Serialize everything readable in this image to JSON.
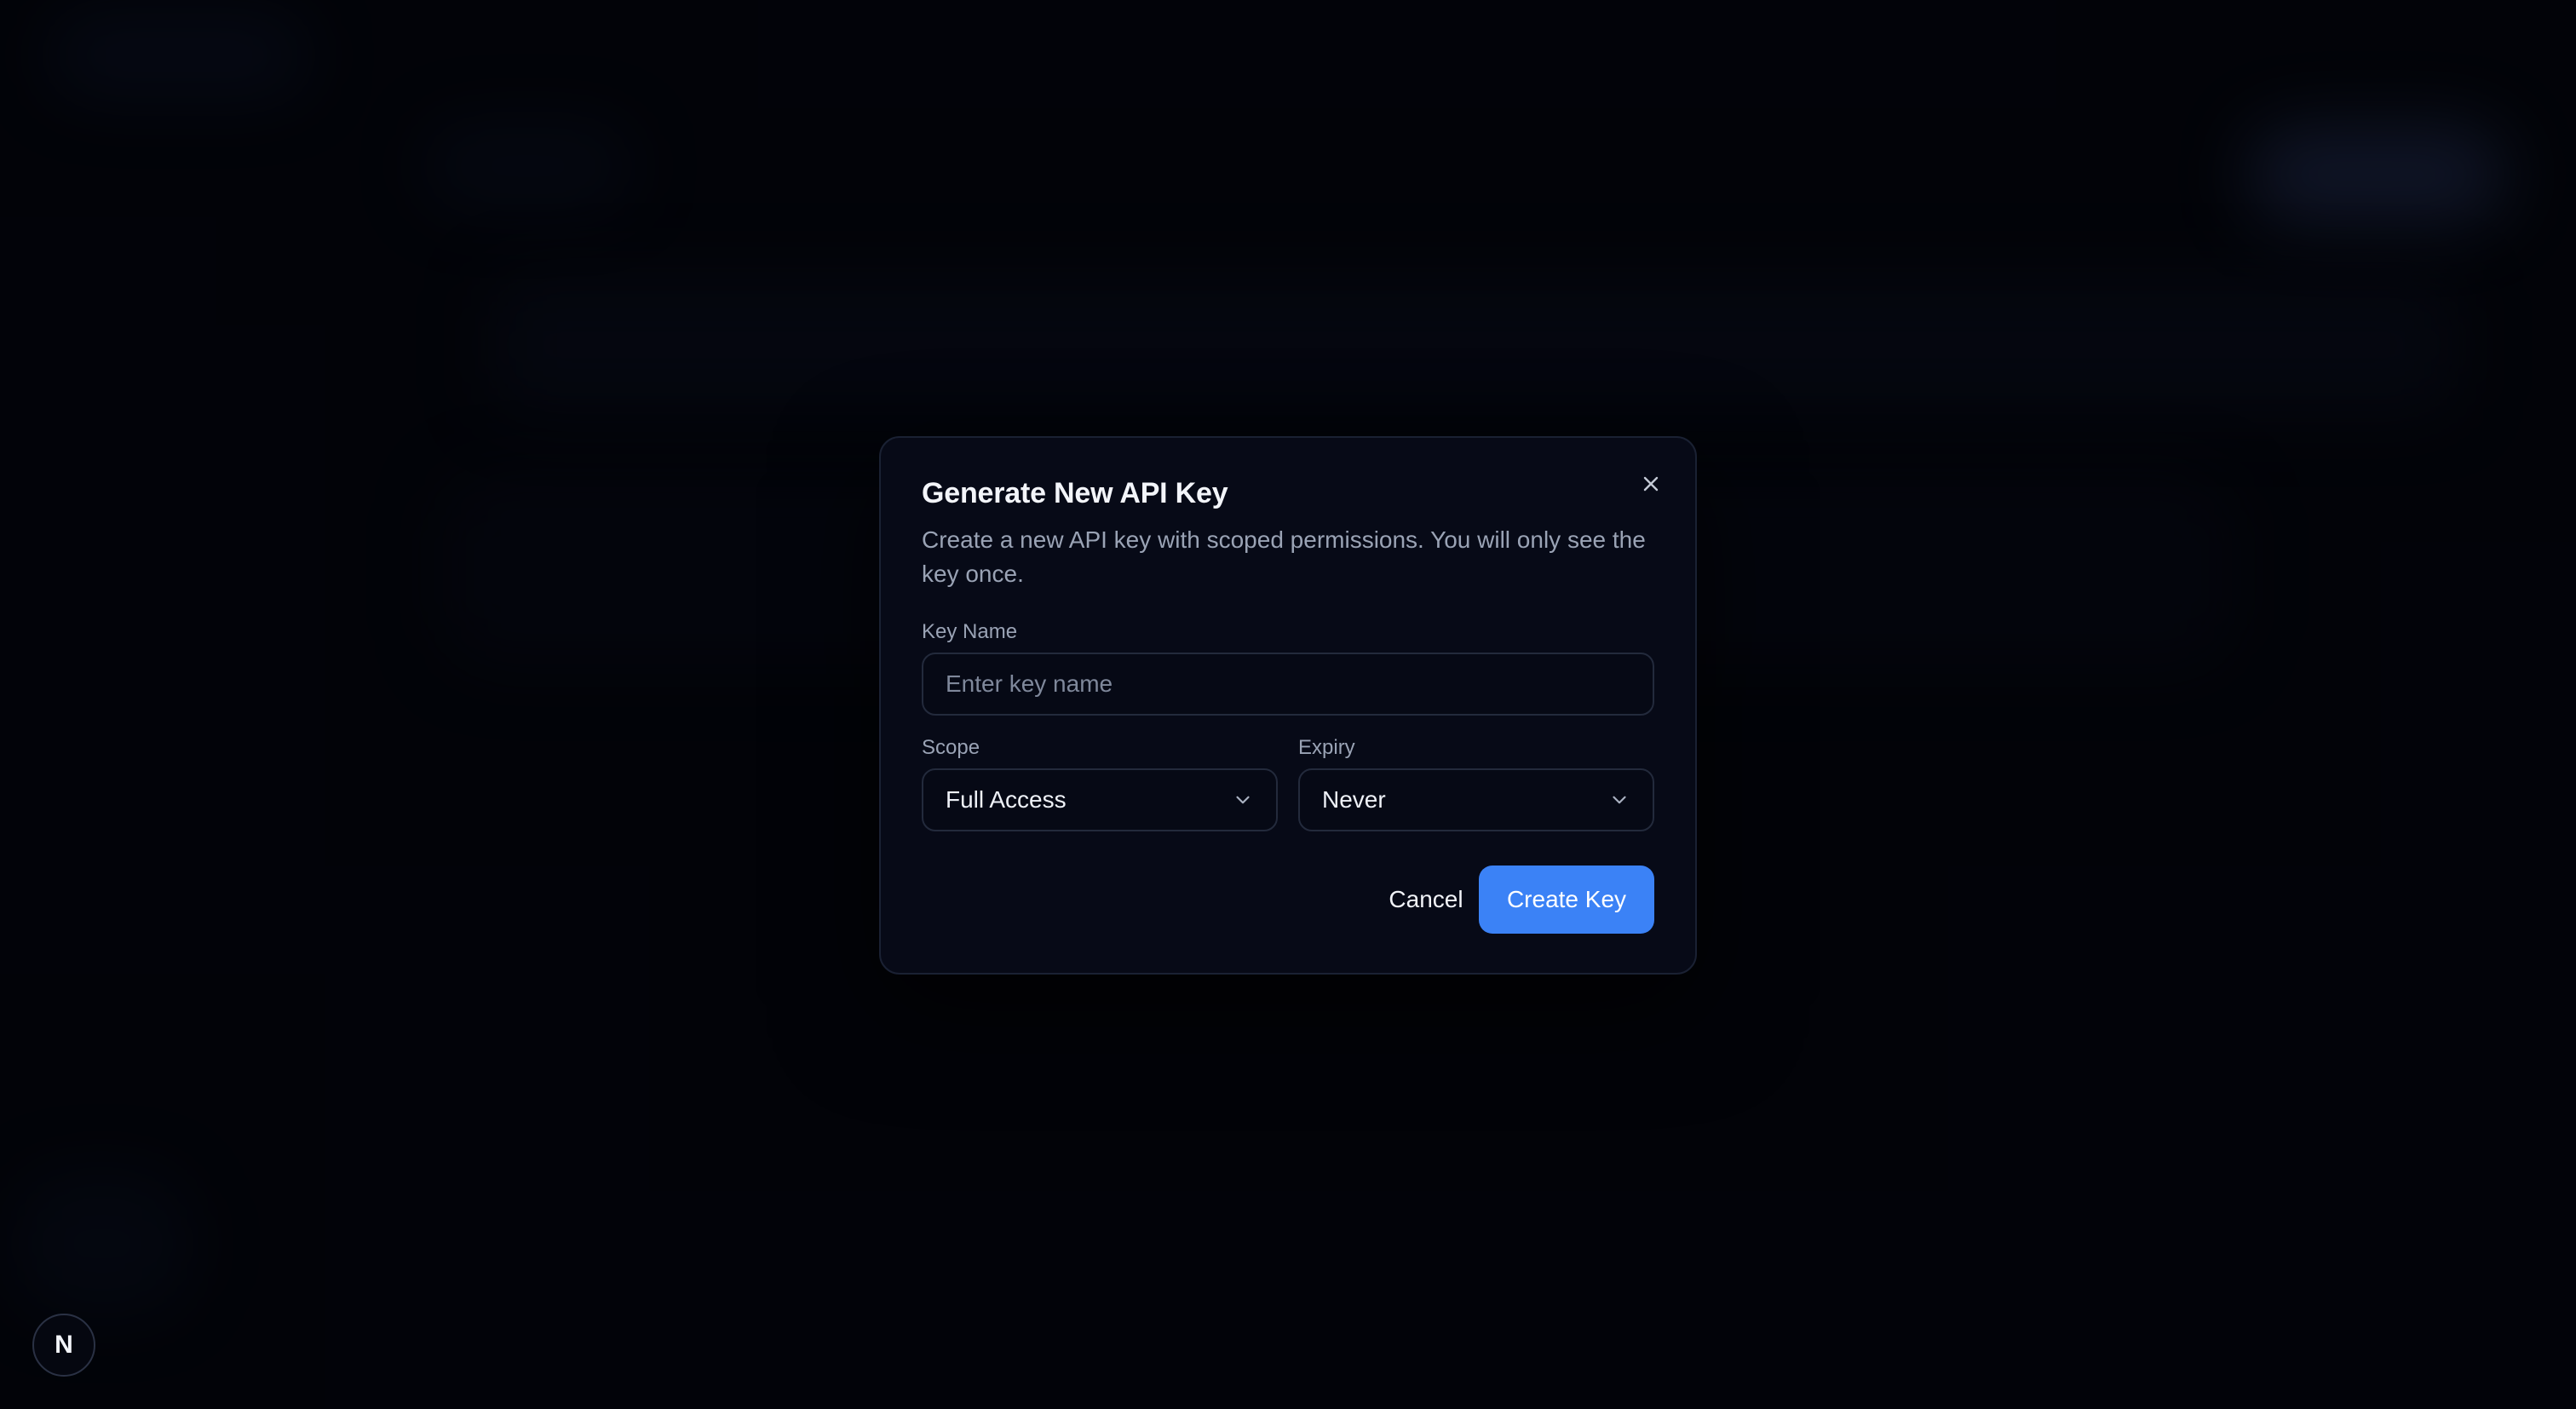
{
  "modal": {
    "title": "Generate New API Key",
    "description": "Create a new API key with scoped permissions. You will only see the key once.",
    "close_icon": "close-icon",
    "key_name": {
      "label": "Key Name",
      "value": "",
      "placeholder": "Enter key name"
    },
    "scope": {
      "label": "Scope",
      "selected": "Full Access",
      "icon": "chevron-down-icon"
    },
    "expiry": {
      "label": "Expiry",
      "selected": "Never",
      "icon": "chevron-down-icon"
    },
    "actions": {
      "cancel_label": "Cancel",
      "create_label": "Create Key"
    }
  },
  "badge": {
    "letter": "N",
    "icon": "framework-logo-icon"
  },
  "colors": {
    "accent": "#3b82f6",
    "modal_background": "#070a17",
    "page_background": "#03040a"
  }
}
